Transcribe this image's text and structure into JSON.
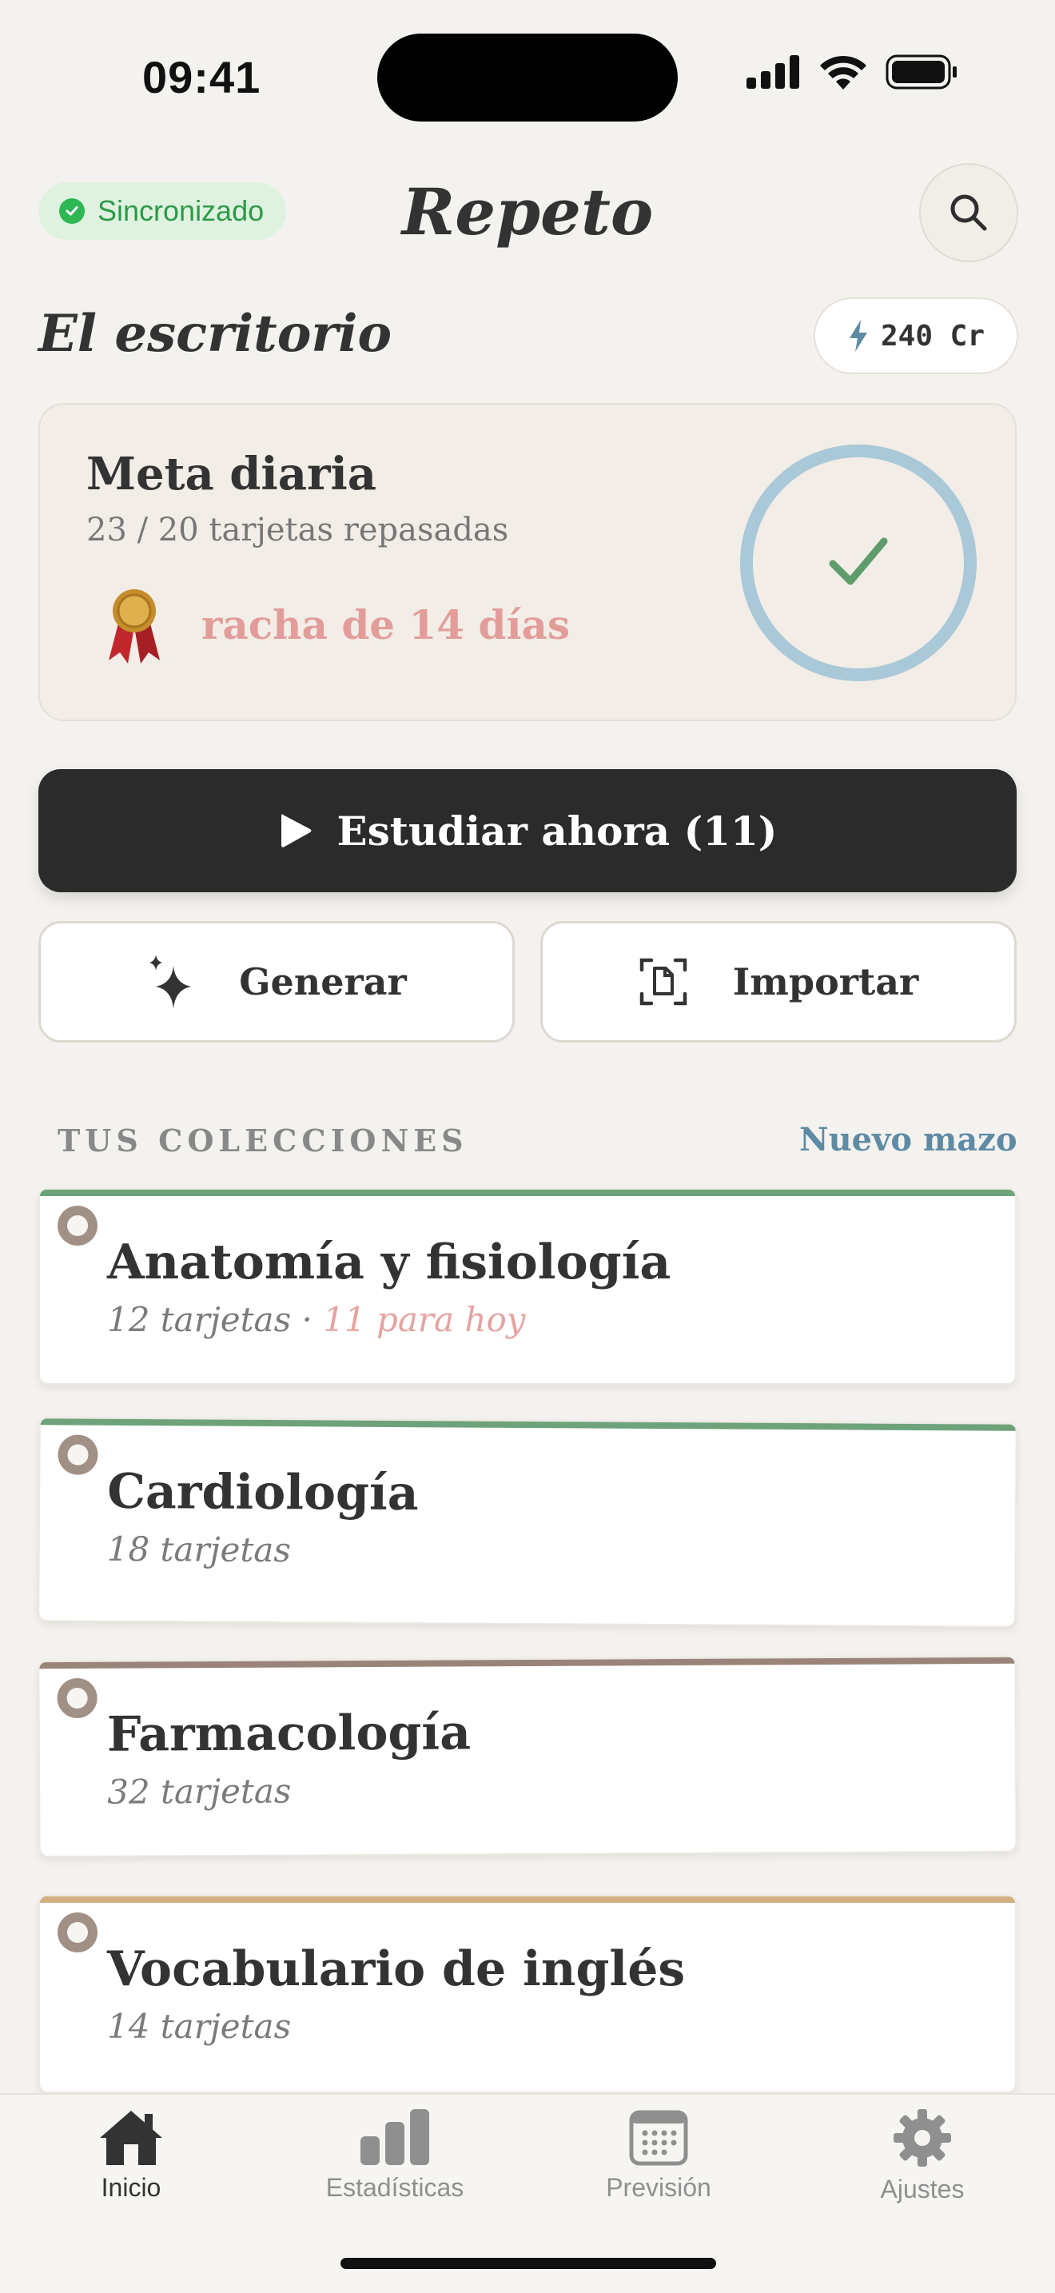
{
  "status_bar": {
    "time": "09:41"
  },
  "header": {
    "sync_label": "Sincronizado",
    "app_title": "Repeto"
  },
  "section_title": "El escritorio",
  "credits": "240 Cr",
  "daily_goal": {
    "title": "Meta diaria",
    "progress": "23 / 20 tarjetas repasadas",
    "reviewed": 23,
    "target": 20,
    "streak": "racha de 14 días"
  },
  "actions": {
    "study": "Estudiar ahora (11)",
    "generate": "Generar",
    "import": "Importar"
  },
  "collections": {
    "label": "TUS COLECCIONES",
    "new_deck": "Nuevo mazo",
    "decks": [
      {
        "title": "Anatomía y fisiología",
        "count": "12 tarjetas",
        "separator": " · ",
        "due": "11 para hoy",
        "color": "#6ea27a"
      },
      {
        "title": "Cardiología",
        "count": "18 tarjetas",
        "separator": "",
        "due": "",
        "color": "#6ea27a"
      },
      {
        "title": "Farmacología",
        "count": "32 tarjetas",
        "separator": "",
        "due": "",
        "color": "#9a8479"
      },
      {
        "title": "Vocabulario de inglés",
        "count": "14 tarjetas",
        "separator": "",
        "due": "",
        "color": "#d2b080"
      }
    ]
  },
  "tabs": [
    {
      "label": "Inicio",
      "icon": "home-icon",
      "active": true
    },
    {
      "label": "Estadísticas",
      "icon": "bar-chart-icon",
      "active": false
    },
    {
      "label": "Previsión",
      "icon": "calendar-icon",
      "active": false
    },
    {
      "label": "Ajustes",
      "icon": "gear-icon",
      "active": false
    }
  ],
  "colors": {
    "accent_dark": "#2b2b2b",
    "sync_green": "#2fb655",
    "streak_pink": "#e29d9a",
    "ring_blue": "#a9c8d8",
    "link_blue": "#5e8aa4"
  }
}
